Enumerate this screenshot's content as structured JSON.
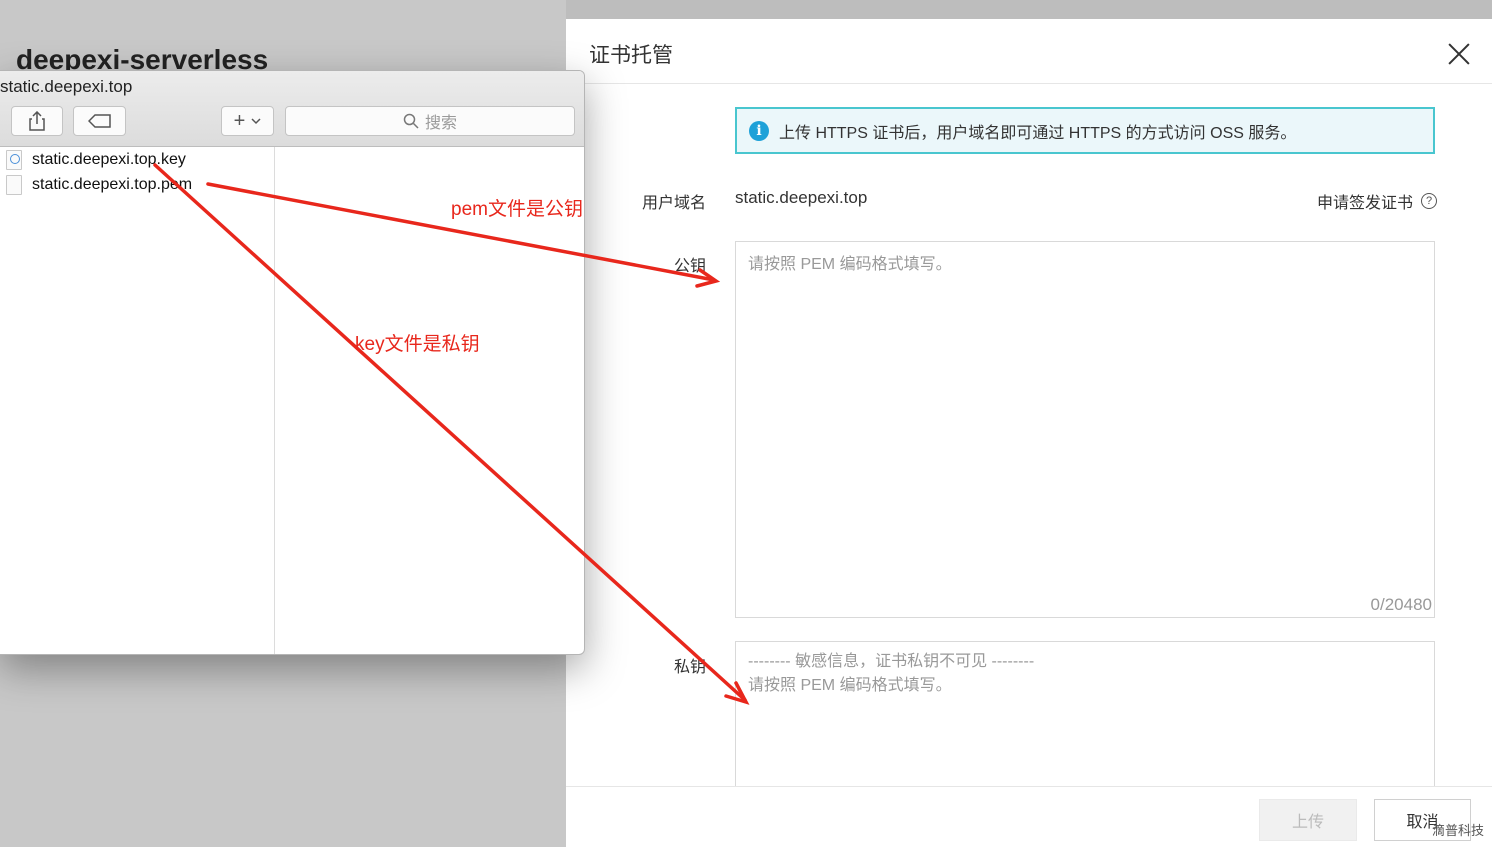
{
  "background": {
    "title": "deepexi-serverless"
  },
  "finder": {
    "window_title": "static.deepexi.top",
    "search_placeholder": "搜索",
    "add_label": "+",
    "files": [
      {
        "name": "static.deepexi.top.key"
      },
      {
        "name": "static.deepexi.top.pem"
      }
    ]
  },
  "drawer": {
    "title": "证书托管",
    "notice": "上传 HTTPS 证书后，用户域名即可通过 HTTPS 的方式访问 OSS 服务。",
    "domain_label": "用户域名",
    "domain_value": "static.deepexi.top",
    "apply_cert_label": "申请签发证书",
    "public_key_label": "公钥",
    "public_key_placeholder": "请按照 PEM 编码格式填写。",
    "public_key_counter": "0/20480",
    "private_key_label": "私钥",
    "private_key_line1": "-------- 敏感信息，证书私钥不可见 --------",
    "private_key_line2": "请按照 PEM 编码格式填写。",
    "upload_button": "上传",
    "cancel_button": "取消"
  },
  "annotations": {
    "pem_note": "pem文件是公钥",
    "key_note": "key文件是私钥",
    "color": "#e8271c"
  },
  "watermark": "滴普科技"
}
